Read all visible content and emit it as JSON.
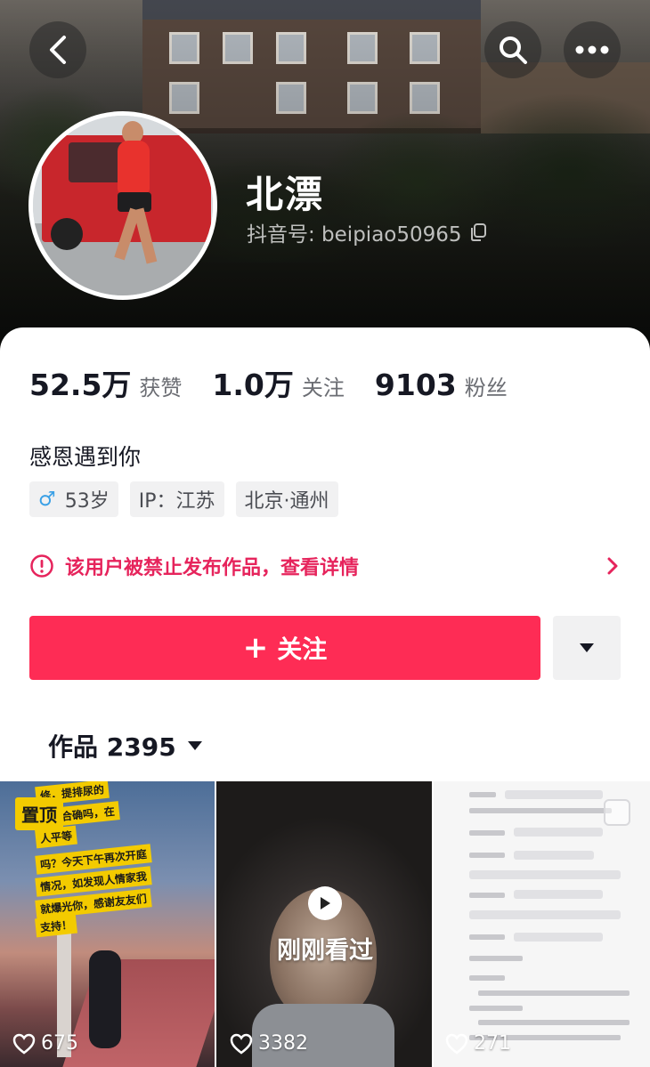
{
  "header": {
    "username": "北漂",
    "douyin_id": "抖音号: beipiao50965",
    "icons": [
      "back-arrow-icon",
      "search-icon",
      "more-icon",
      "copy-icon"
    ]
  },
  "stats": [
    {
      "value": "52.5万",
      "label": "获赞"
    },
    {
      "value": "1.0万",
      "label": "关注"
    },
    {
      "value": "9103",
      "label": "粉丝"
    }
  ],
  "bio": "感恩遇到你",
  "tags": {
    "gender_age": "53岁",
    "ip": "IP：江苏",
    "location": "北京·通州"
  },
  "warning": {
    "text": "该用户被禁止发布作品，查看详情",
    "color": "#e6245c"
  },
  "actions": {
    "follow_plus": "+",
    "follow_label": "关注",
    "accent_color": "#fe2c55"
  },
  "works": {
    "label": "作品 2395"
  },
  "videos": [
    {
      "badge": "置顶",
      "likes": "675",
      "caption_lines": [
        "修，提排尿的",
        "合的合确吗，在",
        "人平等",
        "吗？今天下午再次开庭",
        "情况，如发现人情家我",
        "就爆光你，感谢友友们",
        "支持！"
      ]
    },
    {
      "overlay": "刚刚看过",
      "likes": "3382"
    },
    {
      "likes": "271"
    }
  ]
}
